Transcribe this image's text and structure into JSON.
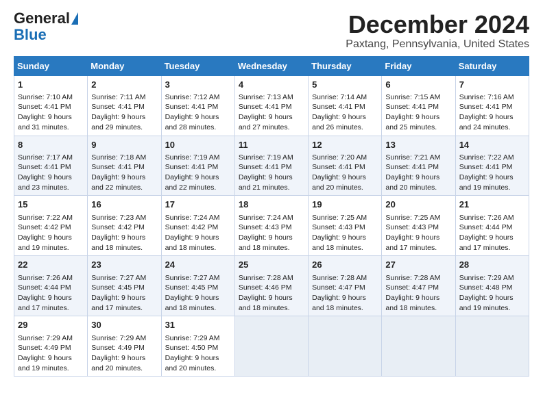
{
  "logo": {
    "general": "General",
    "blue": "Blue"
  },
  "title": "December 2024",
  "subtitle": "Paxtang, Pennsylvania, United States",
  "days_of_week": [
    "Sunday",
    "Monday",
    "Tuesday",
    "Wednesday",
    "Thursday",
    "Friday",
    "Saturday"
  ],
  "weeks": [
    [
      {
        "day": "1",
        "sunrise": "7:10 AM",
        "sunset": "4:41 PM",
        "daylight": "9 hours and 31 minutes."
      },
      {
        "day": "2",
        "sunrise": "7:11 AM",
        "sunset": "4:41 PM",
        "daylight": "9 hours and 29 minutes."
      },
      {
        "day": "3",
        "sunrise": "7:12 AM",
        "sunset": "4:41 PM",
        "daylight": "9 hours and 28 minutes."
      },
      {
        "day": "4",
        "sunrise": "7:13 AM",
        "sunset": "4:41 PM",
        "daylight": "9 hours and 27 minutes."
      },
      {
        "day": "5",
        "sunrise": "7:14 AM",
        "sunset": "4:41 PM",
        "daylight": "9 hours and 26 minutes."
      },
      {
        "day": "6",
        "sunrise": "7:15 AM",
        "sunset": "4:41 PM",
        "daylight": "9 hours and 25 minutes."
      },
      {
        "day": "7",
        "sunrise": "7:16 AM",
        "sunset": "4:41 PM",
        "daylight": "9 hours and 24 minutes."
      }
    ],
    [
      {
        "day": "8",
        "sunrise": "7:17 AM",
        "sunset": "4:41 PM",
        "daylight": "9 hours and 23 minutes."
      },
      {
        "day": "9",
        "sunrise": "7:18 AM",
        "sunset": "4:41 PM",
        "daylight": "9 hours and 22 minutes."
      },
      {
        "day": "10",
        "sunrise": "7:19 AM",
        "sunset": "4:41 PM",
        "daylight": "9 hours and 22 minutes."
      },
      {
        "day": "11",
        "sunrise": "7:19 AM",
        "sunset": "4:41 PM",
        "daylight": "9 hours and 21 minutes."
      },
      {
        "day": "12",
        "sunrise": "7:20 AM",
        "sunset": "4:41 PM",
        "daylight": "9 hours and 20 minutes."
      },
      {
        "day": "13",
        "sunrise": "7:21 AM",
        "sunset": "4:41 PM",
        "daylight": "9 hours and 20 minutes."
      },
      {
        "day": "14",
        "sunrise": "7:22 AM",
        "sunset": "4:41 PM",
        "daylight": "9 hours and 19 minutes."
      }
    ],
    [
      {
        "day": "15",
        "sunrise": "7:22 AM",
        "sunset": "4:42 PM",
        "daylight": "9 hours and 19 minutes."
      },
      {
        "day": "16",
        "sunrise": "7:23 AM",
        "sunset": "4:42 PM",
        "daylight": "9 hours and 18 minutes."
      },
      {
        "day": "17",
        "sunrise": "7:24 AM",
        "sunset": "4:42 PM",
        "daylight": "9 hours and 18 minutes."
      },
      {
        "day": "18",
        "sunrise": "7:24 AM",
        "sunset": "4:43 PM",
        "daylight": "9 hours and 18 minutes."
      },
      {
        "day": "19",
        "sunrise": "7:25 AM",
        "sunset": "4:43 PM",
        "daylight": "9 hours and 18 minutes."
      },
      {
        "day": "20",
        "sunrise": "7:25 AM",
        "sunset": "4:43 PM",
        "daylight": "9 hours and 17 minutes."
      },
      {
        "day": "21",
        "sunrise": "7:26 AM",
        "sunset": "4:44 PM",
        "daylight": "9 hours and 17 minutes."
      }
    ],
    [
      {
        "day": "22",
        "sunrise": "7:26 AM",
        "sunset": "4:44 PM",
        "daylight": "9 hours and 17 minutes."
      },
      {
        "day": "23",
        "sunrise": "7:27 AM",
        "sunset": "4:45 PM",
        "daylight": "9 hours and 17 minutes."
      },
      {
        "day": "24",
        "sunrise": "7:27 AM",
        "sunset": "4:45 PM",
        "daylight": "9 hours and 18 minutes."
      },
      {
        "day": "25",
        "sunrise": "7:28 AM",
        "sunset": "4:46 PM",
        "daylight": "9 hours and 18 minutes."
      },
      {
        "day": "26",
        "sunrise": "7:28 AM",
        "sunset": "4:47 PM",
        "daylight": "9 hours and 18 minutes."
      },
      {
        "day": "27",
        "sunrise": "7:28 AM",
        "sunset": "4:47 PM",
        "daylight": "9 hours and 18 minutes."
      },
      {
        "day": "28",
        "sunrise": "7:29 AM",
        "sunset": "4:48 PM",
        "daylight": "9 hours and 19 minutes."
      }
    ],
    [
      {
        "day": "29",
        "sunrise": "7:29 AM",
        "sunset": "4:49 PM",
        "daylight": "9 hours and 19 minutes."
      },
      {
        "day": "30",
        "sunrise": "7:29 AM",
        "sunset": "4:49 PM",
        "daylight": "9 hours and 20 minutes."
      },
      {
        "day": "31",
        "sunrise": "7:29 AM",
        "sunset": "4:50 PM",
        "daylight": "9 hours and 20 minutes."
      },
      null,
      null,
      null,
      null
    ]
  ]
}
